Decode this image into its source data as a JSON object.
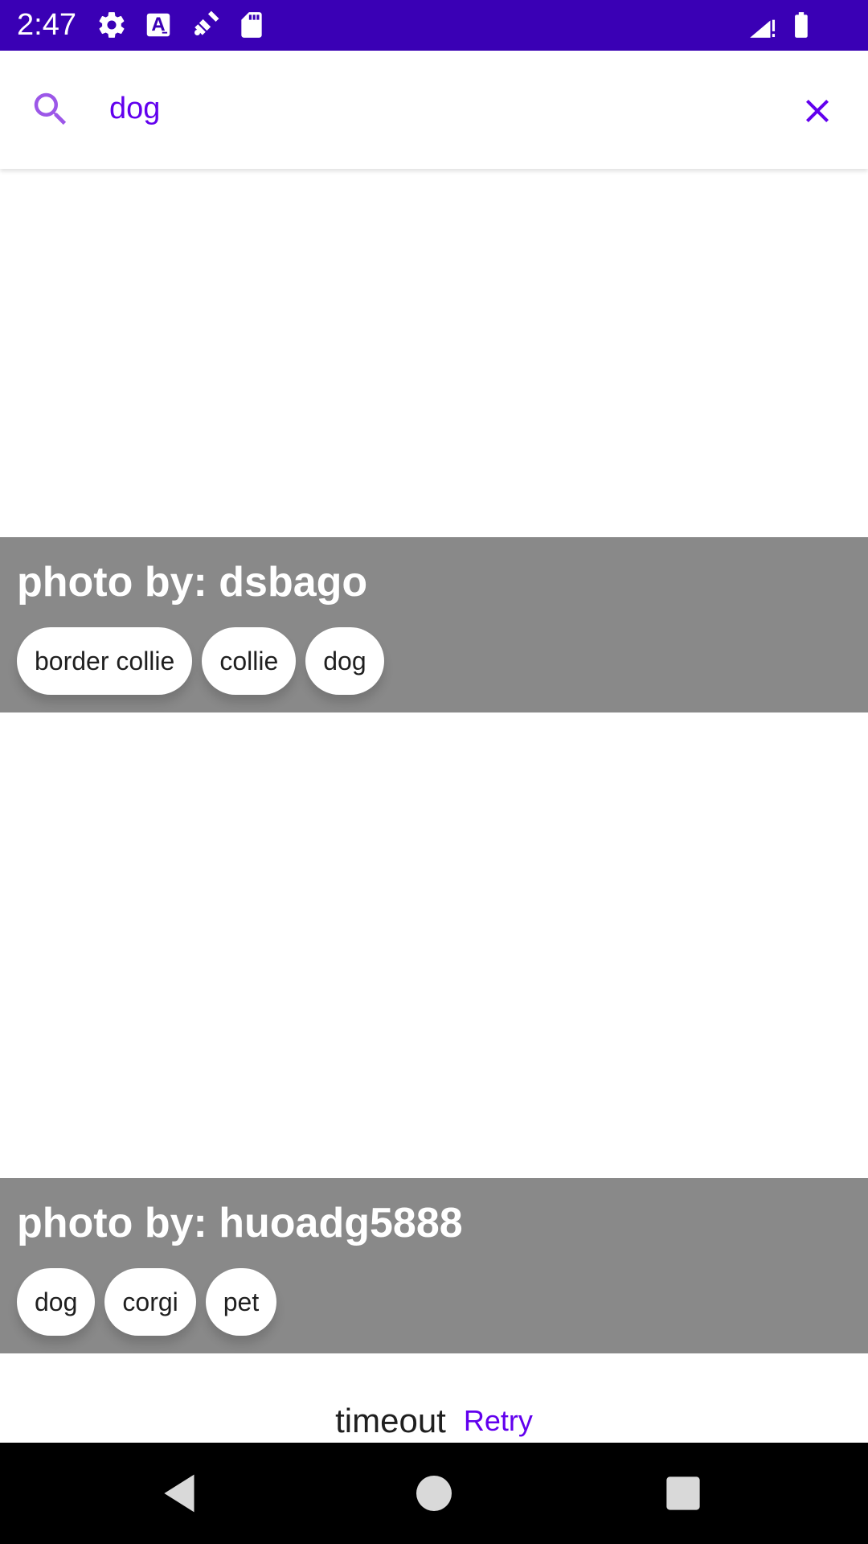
{
  "status_bar": {
    "time": "2:47",
    "background": "#3a00b5",
    "icons": [
      "gear-icon",
      "text-a-icon",
      "satellite-icon",
      "sd-card-icon",
      "signal-icon",
      "battery-icon"
    ]
  },
  "search": {
    "query": "dog",
    "accent": "#6200ee",
    "icon": "search-icon",
    "clear_icon": "close-icon"
  },
  "results": [
    {
      "author": "photo by: dsbago",
      "tags": [
        "border collie",
        "collie",
        "dog"
      ]
    },
    {
      "author": "photo by: huoadg5888",
      "tags": [
        "dog",
        "corgi",
        "pet"
      ]
    }
  ],
  "footer": {
    "message": "timeout",
    "retry_label": "Retry"
  },
  "nav_bar": {
    "buttons": [
      "back-icon",
      "home-icon",
      "recents-icon"
    ]
  }
}
